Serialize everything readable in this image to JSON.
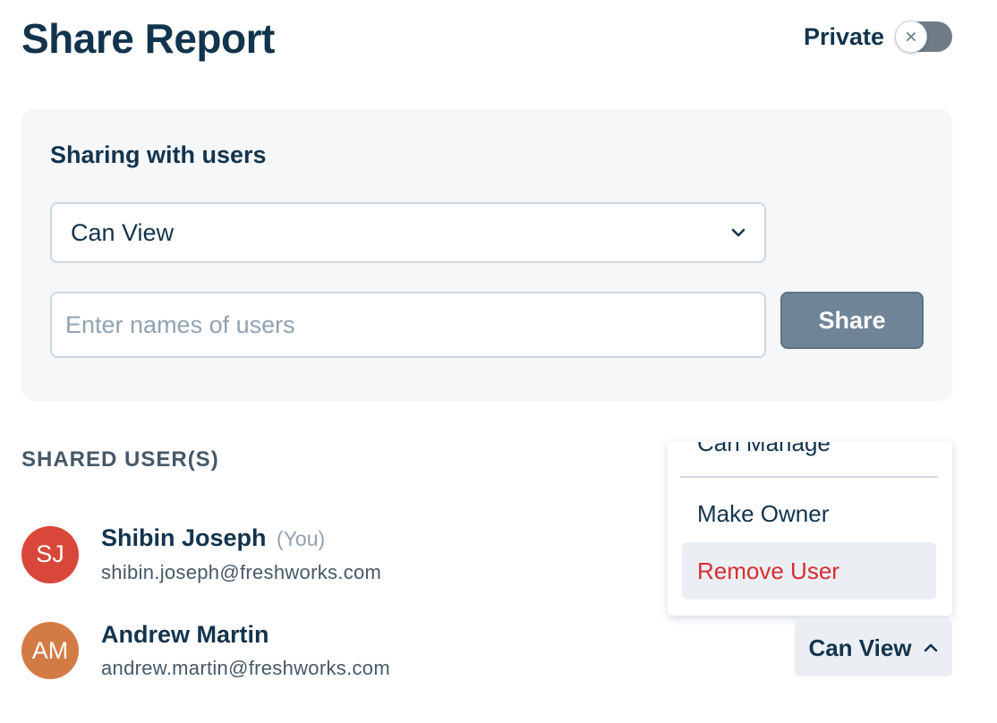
{
  "header": {
    "title": "Share Report",
    "privacy_label": "Private",
    "toggle_on": false,
    "toggle_icon": "close-icon"
  },
  "share_panel": {
    "heading": "Sharing with users",
    "permission_select": {
      "value": "Can View",
      "icon": "chevron-down-icon"
    },
    "user_input": {
      "value": "",
      "placeholder": "Enter names of users"
    },
    "share_button_label": "Share"
  },
  "shared_users": {
    "heading": "SHARED USER(S)",
    "users": [
      {
        "initials": "SJ",
        "name": "Shibin Joseph",
        "suffix": "(You)",
        "email": "shibin.joseph@freshworks.com",
        "avatar_color": "#d9463a"
      },
      {
        "initials": "AM",
        "name": "Andrew Martin",
        "email": "andrew.martin@freshworks.com",
        "avatar_color": "#d37b45",
        "role": "Can View",
        "role_icon": "chevron-up-icon"
      }
    ]
  },
  "role_menu": {
    "items": [
      "Can Manage",
      "Make Owner",
      "Remove User"
    ],
    "danger_color": "#d72d30"
  }
}
